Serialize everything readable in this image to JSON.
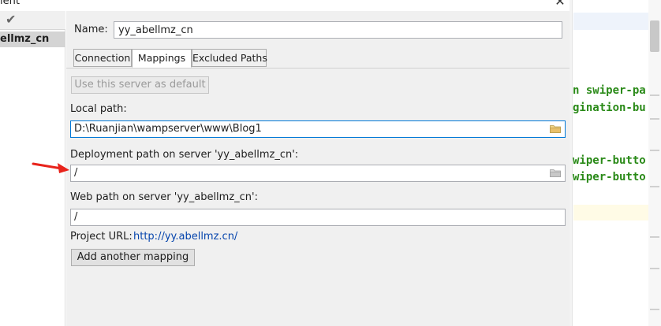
{
  "window": {
    "title_fragment": "ient",
    "close_glyph": "✕"
  },
  "sidebar": {
    "check_glyph": "✔",
    "selected_server": "ellmz_cn"
  },
  "form": {
    "name_label": "Name:",
    "name_value": "yy_abellmz_cn"
  },
  "tabs": [
    {
      "label": "Connection",
      "active": false
    },
    {
      "label": "Mappings",
      "active": true
    },
    {
      "label": "Excluded Paths",
      "active": false
    }
  ],
  "mappings": {
    "default_button": "Use this server as default",
    "local_path_label": "Local path:",
    "local_path_value": "D:\\Ruanjian\\wampserver\\www\\Blog1",
    "deployment_path_label": "Deployment path on server 'yy_abellmz_cn':",
    "deployment_path_value": "/",
    "web_path_label": "Web path on server 'yy_abellmz_cn':",
    "web_path_value": "/",
    "project_url_label": "Project URL:",
    "project_url_value": "http://yy.abellmz.cn/",
    "add_mapping_button": "Add another mapping"
  },
  "editor": {
    "lines": [
      "n swiper-pa",
      "gination-bu",
      "wiper-butto",
      "wiper-butto"
    ]
  },
  "colors": {
    "accent": "#0078d7",
    "link": "#0645ad",
    "code_green": "#2a8a18",
    "arrow_red": "#e8231b"
  }
}
